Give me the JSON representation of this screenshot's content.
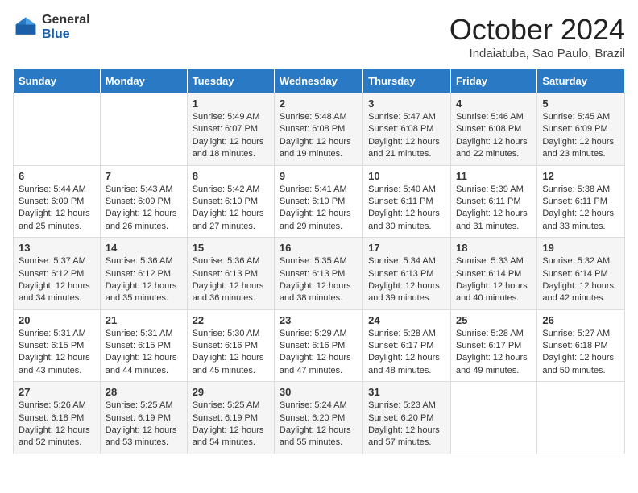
{
  "header": {
    "logo_general": "General",
    "logo_blue": "Blue",
    "month_title": "October 2024",
    "location": "Indaiatuba, Sao Paulo, Brazil"
  },
  "weekdays": [
    "Sunday",
    "Monday",
    "Tuesday",
    "Wednesday",
    "Thursday",
    "Friday",
    "Saturday"
  ],
  "weeks": [
    [
      {
        "day": "",
        "info": ""
      },
      {
        "day": "",
        "info": ""
      },
      {
        "day": "1",
        "info": "Sunrise: 5:49 AM\nSunset: 6:07 PM\nDaylight: 12 hours and 18 minutes."
      },
      {
        "day": "2",
        "info": "Sunrise: 5:48 AM\nSunset: 6:08 PM\nDaylight: 12 hours and 19 minutes."
      },
      {
        "day": "3",
        "info": "Sunrise: 5:47 AM\nSunset: 6:08 PM\nDaylight: 12 hours and 21 minutes."
      },
      {
        "day": "4",
        "info": "Sunrise: 5:46 AM\nSunset: 6:08 PM\nDaylight: 12 hours and 22 minutes."
      },
      {
        "day": "5",
        "info": "Sunrise: 5:45 AM\nSunset: 6:09 PM\nDaylight: 12 hours and 23 minutes."
      }
    ],
    [
      {
        "day": "6",
        "info": "Sunrise: 5:44 AM\nSunset: 6:09 PM\nDaylight: 12 hours and 25 minutes."
      },
      {
        "day": "7",
        "info": "Sunrise: 5:43 AM\nSunset: 6:09 PM\nDaylight: 12 hours and 26 minutes."
      },
      {
        "day": "8",
        "info": "Sunrise: 5:42 AM\nSunset: 6:10 PM\nDaylight: 12 hours and 27 minutes."
      },
      {
        "day": "9",
        "info": "Sunrise: 5:41 AM\nSunset: 6:10 PM\nDaylight: 12 hours and 29 minutes."
      },
      {
        "day": "10",
        "info": "Sunrise: 5:40 AM\nSunset: 6:11 PM\nDaylight: 12 hours and 30 minutes."
      },
      {
        "day": "11",
        "info": "Sunrise: 5:39 AM\nSunset: 6:11 PM\nDaylight: 12 hours and 31 minutes."
      },
      {
        "day": "12",
        "info": "Sunrise: 5:38 AM\nSunset: 6:11 PM\nDaylight: 12 hours and 33 minutes."
      }
    ],
    [
      {
        "day": "13",
        "info": "Sunrise: 5:37 AM\nSunset: 6:12 PM\nDaylight: 12 hours and 34 minutes."
      },
      {
        "day": "14",
        "info": "Sunrise: 5:36 AM\nSunset: 6:12 PM\nDaylight: 12 hours and 35 minutes."
      },
      {
        "day": "15",
        "info": "Sunrise: 5:36 AM\nSunset: 6:13 PM\nDaylight: 12 hours and 36 minutes."
      },
      {
        "day": "16",
        "info": "Sunrise: 5:35 AM\nSunset: 6:13 PM\nDaylight: 12 hours and 38 minutes."
      },
      {
        "day": "17",
        "info": "Sunrise: 5:34 AM\nSunset: 6:13 PM\nDaylight: 12 hours and 39 minutes."
      },
      {
        "day": "18",
        "info": "Sunrise: 5:33 AM\nSunset: 6:14 PM\nDaylight: 12 hours and 40 minutes."
      },
      {
        "day": "19",
        "info": "Sunrise: 5:32 AM\nSunset: 6:14 PM\nDaylight: 12 hours and 42 minutes."
      }
    ],
    [
      {
        "day": "20",
        "info": "Sunrise: 5:31 AM\nSunset: 6:15 PM\nDaylight: 12 hours and 43 minutes."
      },
      {
        "day": "21",
        "info": "Sunrise: 5:31 AM\nSunset: 6:15 PM\nDaylight: 12 hours and 44 minutes."
      },
      {
        "day": "22",
        "info": "Sunrise: 5:30 AM\nSunset: 6:16 PM\nDaylight: 12 hours and 45 minutes."
      },
      {
        "day": "23",
        "info": "Sunrise: 5:29 AM\nSunset: 6:16 PM\nDaylight: 12 hours and 47 minutes."
      },
      {
        "day": "24",
        "info": "Sunrise: 5:28 AM\nSunset: 6:17 PM\nDaylight: 12 hours and 48 minutes."
      },
      {
        "day": "25",
        "info": "Sunrise: 5:28 AM\nSunset: 6:17 PM\nDaylight: 12 hours and 49 minutes."
      },
      {
        "day": "26",
        "info": "Sunrise: 5:27 AM\nSunset: 6:18 PM\nDaylight: 12 hours and 50 minutes."
      }
    ],
    [
      {
        "day": "27",
        "info": "Sunrise: 5:26 AM\nSunset: 6:18 PM\nDaylight: 12 hours and 52 minutes."
      },
      {
        "day": "28",
        "info": "Sunrise: 5:25 AM\nSunset: 6:19 PM\nDaylight: 12 hours and 53 minutes."
      },
      {
        "day": "29",
        "info": "Sunrise: 5:25 AM\nSunset: 6:19 PM\nDaylight: 12 hours and 54 minutes."
      },
      {
        "day": "30",
        "info": "Sunrise: 5:24 AM\nSunset: 6:20 PM\nDaylight: 12 hours and 55 minutes."
      },
      {
        "day": "31",
        "info": "Sunrise: 5:23 AM\nSunset: 6:20 PM\nDaylight: 12 hours and 57 minutes."
      },
      {
        "day": "",
        "info": ""
      },
      {
        "day": "",
        "info": ""
      }
    ]
  ]
}
